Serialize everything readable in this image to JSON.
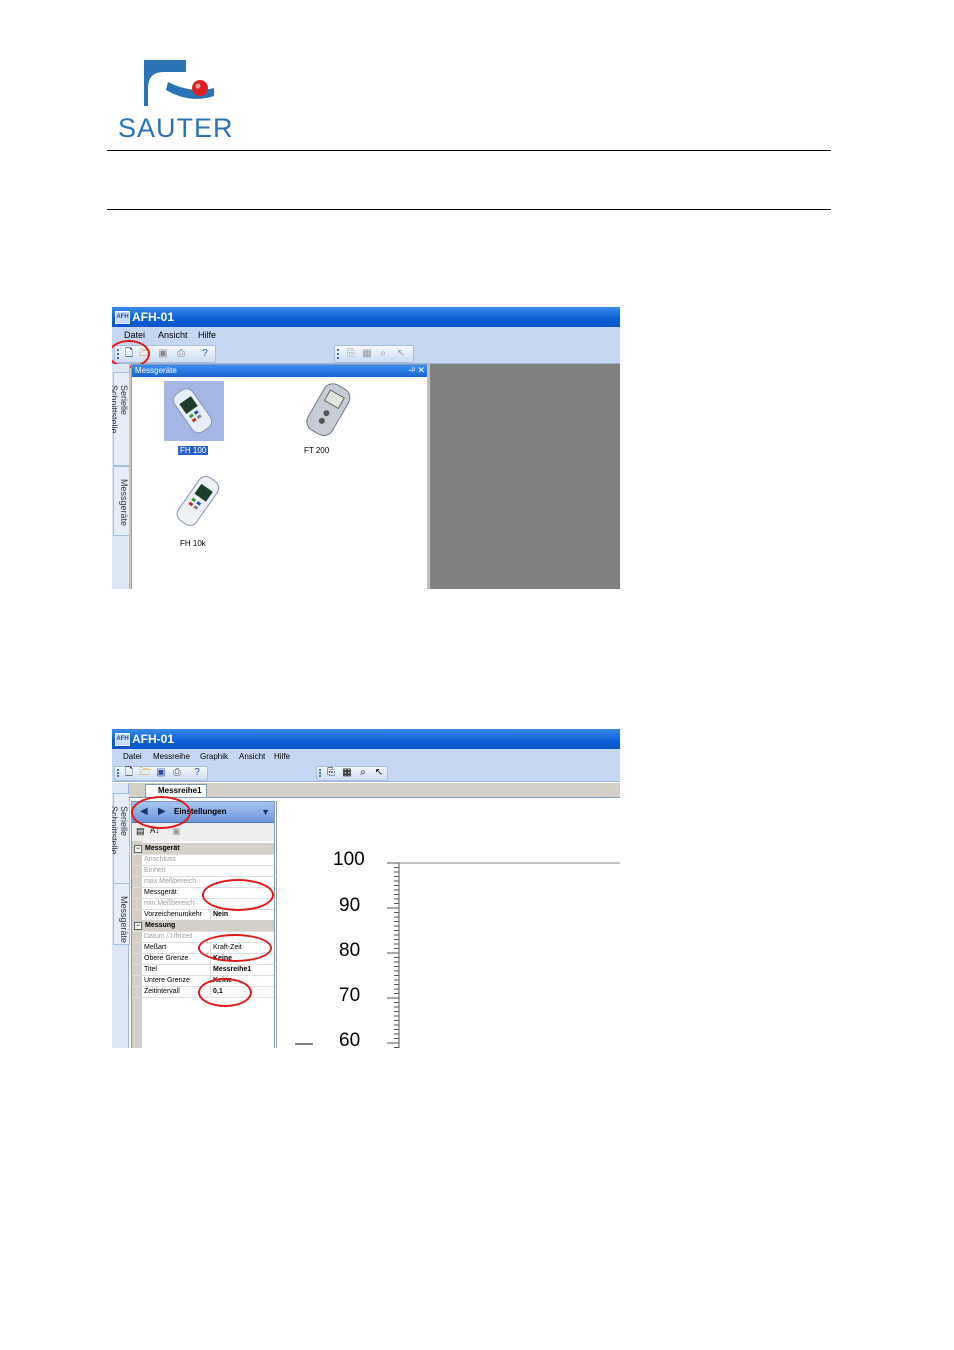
{
  "logo": {
    "brand": "SAUTER"
  },
  "window1": {
    "title": "AFH-01",
    "menu": [
      "Datei",
      "Ansicht",
      "Hilfe"
    ],
    "side_tabs": [
      "Serielle Schnittstelle",
      "Messgeräte"
    ],
    "panel_title": "Messgeräte",
    "panel_buttons": "-ᵖ ✕",
    "devices": [
      "FH 100",
      "FT 200",
      "FH 10k"
    ]
  },
  "window2": {
    "title": "AFH-01",
    "menu": [
      "Datei",
      "Messreihe",
      "Graphik",
      "Ansicht",
      "Hilfe"
    ],
    "side_tabs": [
      "Serielle Schnittstelle",
      "Messgeräte"
    ],
    "doc_tab": "Messreihe1",
    "settings_title": "Einstellungen",
    "categories": {
      "device": "Messgerät",
      "measurement": "Messung"
    },
    "device_props": [
      {
        "key": "Anschluss",
        "value": "",
        "disabled": true
      },
      {
        "key": "Einheit",
        "value": "",
        "disabled": true
      },
      {
        "key": "max.Meßbereich",
        "value": "",
        "disabled": true
      },
      {
        "key": "Messgerät",
        "value": "",
        "disabled": false
      },
      {
        "key": "min.Meßbereich",
        "value": "",
        "disabled": true
      },
      {
        "key": "Vorzeichenumkehr",
        "value": "Nein",
        "disabled": false
      }
    ],
    "measure_props": [
      {
        "key": "Datum / Uhrzeit",
        "value": "",
        "disabled": true
      },
      {
        "key": "Meßart",
        "value": "Kraft-Zeit",
        "disabled": false
      },
      {
        "key": "Obere Grenze",
        "value": "Keine",
        "disabled": false
      },
      {
        "key": "Titel",
        "value": "Messreihe1",
        "disabled": false
      },
      {
        "key": "Untere Grenze",
        "value": "Keine",
        "disabled": false
      },
      {
        "key": "Zeitintervall",
        "value": "0,1",
        "disabled": false
      }
    ],
    "chart_y_ticks": [
      "100",
      "90",
      "80",
      "70",
      "60"
    ]
  },
  "colors": {
    "highlight": "#e01a1a",
    "titlebar": "#0a5fd8"
  }
}
